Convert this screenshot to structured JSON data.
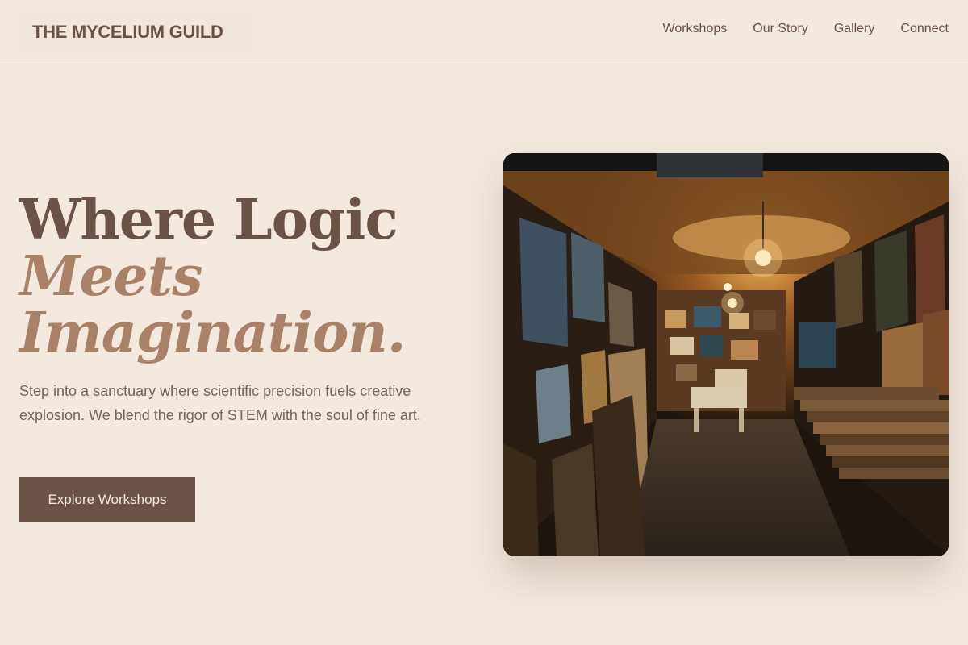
{
  "header": {
    "brand": "THE MYCELIUM GUILD",
    "nav": [
      {
        "label": "Workshops"
      },
      {
        "label": "Our Story"
      },
      {
        "label": "Gallery"
      },
      {
        "label": "Connect"
      }
    ]
  },
  "hero": {
    "headline_line1": "Where Logic",
    "headline_line2": "Meets",
    "headline_line3": "Imagination.",
    "subtext": "Step into a sanctuary where scientific precision fuels creative explosion. We blend the rigor of STEM with the soul of fine art.",
    "cta_label": "Explore Workshops",
    "image_alt": "Narrow art gallery corridor packed with framed paintings under a warm hanging light"
  },
  "colors": {
    "background": "#f3e9df",
    "primary": "#6b5247",
    "accent": "#a88166"
  }
}
